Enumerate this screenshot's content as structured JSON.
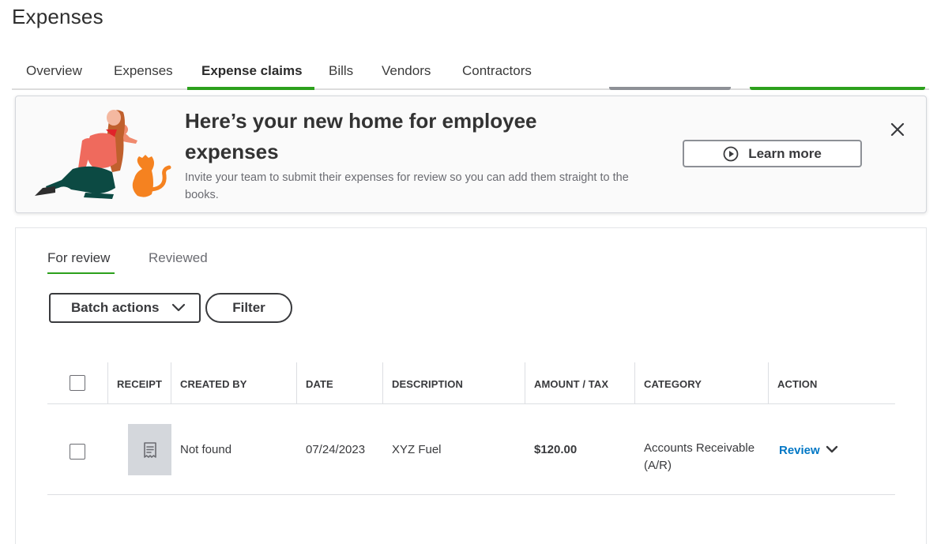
{
  "page": {
    "title": "Expenses"
  },
  "tabs": [
    {
      "label": "Overview"
    },
    {
      "label": "Expenses"
    },
    {
      "label": "Expense claims"
    },
    {
      "label": "Bills"
    },
    {
      "label": "Vendors"
    },
    {
      "label": "Contractors"
    }
  ],
  "banner": {
    "title": "Here’s your new home for employee expenses",
    "description": "Invite your team to submit their expenses for review so you can add them straight to the books.",
    "learn_more_label": "Learn more"
  },
  "subtabs": [
    {
      "label": "For review"
    },
    {
      "label": "Reviewed"
    }
  ],
  "toolbar": {
    "batch_actions_label": "Batch actions",
    "filter_label": "Filter"
  },
  "table": {
    "headers": [
      "RECEIPT",
      "CREATED BY",
      "DATE",
      "DESCRIPTION",
      "AMOUNT / TAX",
      "CATEGORY",
      "ACTION"
    ],
    "rows": [
      {
        "created_by": "Not found",
        "date": "07/24/2023",
        "description": "XYZ Fuel",
        "amount": "$120.00",
        "category": "Accounts Receivable (A/R)",
        "action": "Review"
      }
    ]
  },
  "colors": {
    "accent_green": "#2ca01c",
    "link_blue": "#0077c5",
    "text": "#393a3d"
  }
}
